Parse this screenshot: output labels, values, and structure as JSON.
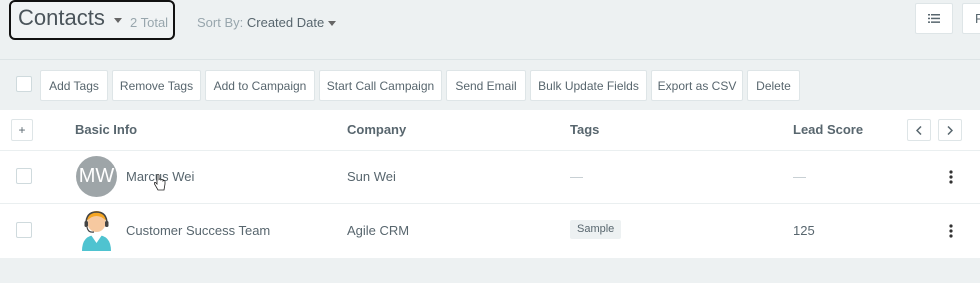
{
  "header": {
    "title": "Contacts",
    "total": "2 Total",
    "sort_label": "Sort By:",
    "sort_value": "Created Date",
    "right_partial_label": "F"
  },
  "toolbar": {
    "buttons": [
      "Add Tags",
      "Remove Tags",
      "Add to Campaign",
      "Start Call Campaign",
      "Send Email",
      "Bulk Update Fields",
      "Export as CSV",
      "Delete"
    ]
  },
  "table": {
    "add_column": "+",
    "columns": [
      "Basic Info",
      "Company",
      "Tags",
      "Lead Score"
    ],
    "rows": [
      {
        "avatar_initials": "MW",
        "name": "Marcus Wei",
        "company": "Sun Wei",
        "tags": "—",
        "lead_score": "—"
      },
      {
        "avatar_icon": "support-agent-avatar-icon",
        "name": "Customer Success Team",
        "company": "Agile CRM",
        "tags": "Sample",
        "lead_score": "125"
      }
    ]
  },
  "colors": {
    "background": "#edf1f2",
    "text": "#58666e",
    "muted": "#98a6ad",
    "avatar_gray": "#9ea5a8"
  }
}
